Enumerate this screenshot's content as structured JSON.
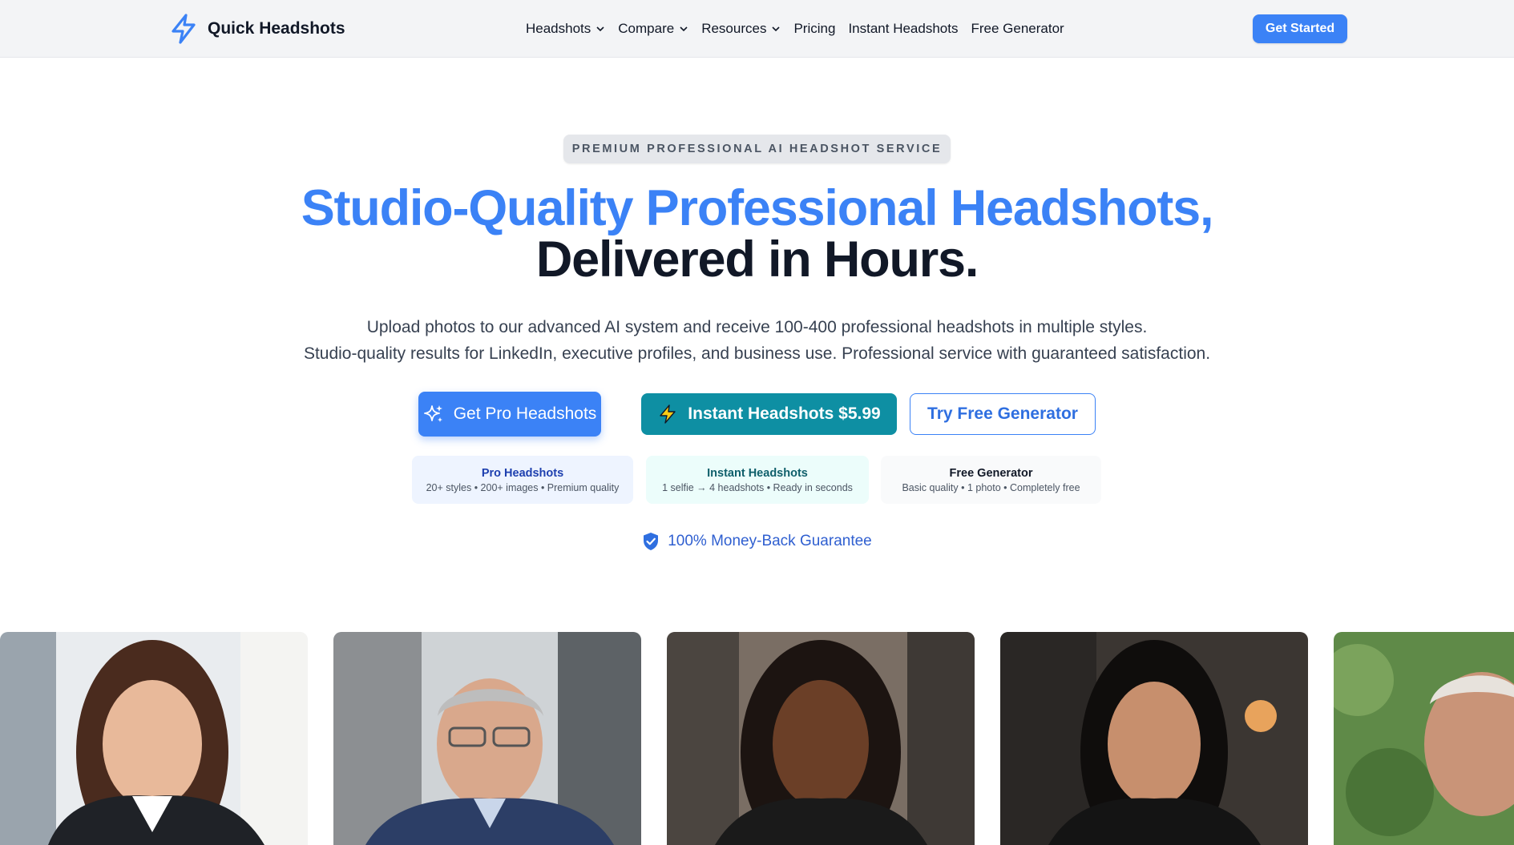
{
  "nav": {
    "brand": "Quick Headshots",
    "links": [
      {
        "label": "Headshots",
        "dropdown": true
      },
      {
        "label": "Compare",
        "dropdown": true
      },
      {
        "label": "Resources",
        "dropdown": true
      },
      {
        "label": "Pricing",
        "dropdown": false
      },
      {
        "label": "Instant Headshots",
        "dropdown": false
      },
      {
        "label": "Free Generator",
        "dropdown": false
      }
    ],
    "cta": "Get Started"
  },
  "hero": {
    "badge": "PREMIUM PROFESSIONAL AI HEADSHOT SERVICE",
    "headline_line1": "Studio-Quality Professional Headshots,",
    "headline_line2": "Delivered in Hours.",
    "subtitle_line1": "Upload photos to our advanced AI system and receive 100-400 professional headshots in multiple styles.",
    "subtitle_line2": "Studio-quality results for LinkedIn, executive profiles, and business use. Professional service with guaranteed satisfaction."
  },
  "buttons": {
    "pro": "Get Pro Headshots",
    "instant": "Instant Headshots $5.99",
    "free": "Try Free Generator"
  },
  "cards": [
    {
      "title": "Pro Headshots",
      "desc": "20+ styles • 200+ images • Premium quality"
    },
    {
      "title": "Instant Headshots",
      "desc": "1 selfie → 4 headshots • Ready in seconds"
    },
    {
      "title": "Free Generator",
      "desc": "Basic quality • 1 photo • Completely free"
    }
  ],
  "guarantee": "100% Money-Back Guarantee",
  "icons": {
    "logo": "lightning-bolt-icon",
    "chevron": "chevron-down-icon",
    "pro": "sparkles-icon",
    "instant": "lightning-icon",
    "guarantee": "shield-check-icon"
  },
  "colors": {
    "brand_blue": "#3b82f6",
    "teal": "#0e8fa3",
    "nav_bg": "#f3f4f6",
    "text_dark": "#111827"
  }
}
